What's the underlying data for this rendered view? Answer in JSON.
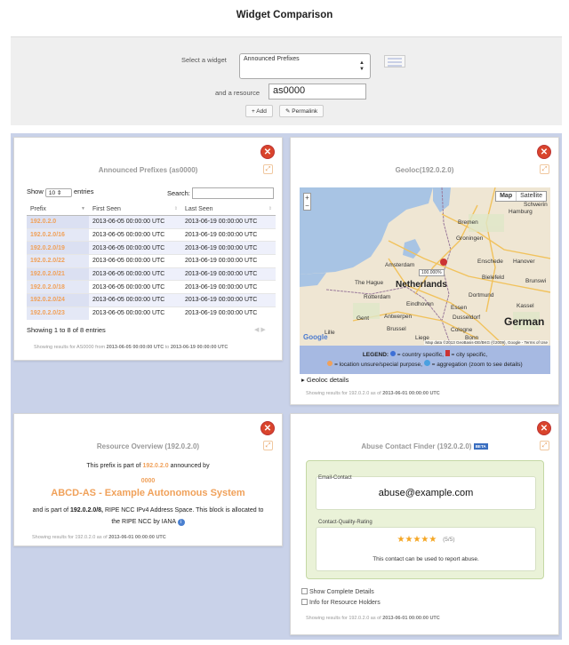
{
  "page": {
    "title": "Widget Comparison"
  },
  "toolbar": {
    "select_label": "Select a widget",
    "select_value": "Announced Prefixes",
    "resource_label": "and a resource",
    "resource_value": "as0000",
    "add_label": "Add",
    "permalink_label": "Permalink"
  },
  "announced": {
    "title": "Announced Prefixes",
    "title_res": "(as0000)",
    "show": "Show",
    "show_value": "10",
    "entries": "entries",
    "search": "Search:",
    "columns": [
      "Prefix",
      "First Seen",
      "Last Seen"
    ],
    "rows": [
      [
        "192.0.2.0",
        "2013-06-05 00:00:00 UTC",
        "2013-06-19 00:00:00 UTC"
      ],
      [
        "192.0.2.0/16",
        "2013-06-05 00:00:00 UTC",
        "2013-06-19 00:00:00 UTC"
      ],
      [
        "192.0.2.0/19",
        "2013-06-05 00:00:00 UTC",
        "2013-06-19 00:00:00 UTC"
      ],
      [
        "192.0.2.0/22",
        "2013-06-05 00:00:00 UTC",
        "2013-06-19 00:00:00 UTC"
      ],
      [
        "192.0.2.0/21",
        "2013-06-05 00:00:00 UTC",
        "2013-06-19 00:00:00 UTC"
      ],
      [
        "192.0.2.0/18",
        "2013-06-05 00:00:00 UTC",
        "2013-06-19 00:00:00 UTC"
      ],
      [
        "192.0.2.0/24",
        "2013-06-05 00:00:00 UTC",
        "2013-06-19 00:00:00 UTC"
      ],
      [
        "192.0.2.0/23",
        "2013-06-05 00:00:00 UTC",
        "2013-06-19 00:00:00 UTC"
      ]
    ],
    "info": "Showing 1 to 8 of 8 entries",
    "foot_pre": "Showing results for",
    "foot_res": "AS0000",
    "foot_from": "from",
    "foot_start": "2013-06-05 00:00:00 UTC",
    "foot_to": "to",
    "foot_end": "2013-06-19 00:00:00 UTC"
  },
  "geoloc": {
    "title": "Geoloc",
    "title_res": "(192.0.2.0)",
    "map_btn": "Map",
    "sat_btn": "Satellite",
    "zoom_in": "+",
    "zoom_out": "−",
    "percent": "100.000%",
    "cities": [
      "Amsterdam",
      "Hamburg",
      "Bremen",
      "The Hague",
      "Rotterdam",
      "Netherlands",
      "Bielefeld",
      "Hanover",
      "Eindhoven",
      "Dortmund",
      "Brunswi",
      "Essen",
      "Antwerpen",
      "Dusseldorf",
      "Gent",
      "Cologne",
      "Bonn",
      "Kassel",
      "German",
      "Lille",
      "Groningen",
      "Schwerin",
      "Brussel",
      "Liege",
      "Enschede"
    ],
    "google": "Google",
    "map_credit": "Map data ©2013 GeoBasis-DE/BKG (©2009), Google - Terms of Use",
    "legend_label": "LEGEND:",
    "legend_country": "= country specific,",
    "legend_city": "= city specific,",
    "legend_unsure": "= location unsure/special purpose,",
    "legend_agg": "= aggregation (zoom to see details)",
    "details": "Geoloc details",
    "foot_pre": "Showing results for",
    "foot_res": "192.0.2.0",
    "foot_as": "as of",
    "foot_date": "2013-06-01 00:00:00 UTC"
  },
  "overview": {
    "title": "Resource Overview",
    "title_res": "(192.0.2.0)",
    "line1_pre": "This prefix is part of",
    "line1_prefix": "192.0.2.0",
    "line1_post": "announced by",
    "asn": "0000",
    "asname": "ABCD-AS - Example Autonomous System",
    "line2_pre": "and is part of",
    "line2_block": "192.0.2.0/8,",
    "line2_post": "RIPE NCC IPv4 Address Space. This block is allocated to",
    "line3": "the RIPE NCC by IANA",
    "foot_pre": "Showing results for",
    "foot_res": "192.0.2.0",
    "foot_as": "as of",
    "foot_date": "2013-06-01 00:00:00 UTC"
  },
  "abuse": {
    "title": "Abuse Contact Finder",
    "title_res": "(192.0.2.0)",
    "beta": "BETA",
    "email_label": "Email-Contact",
    "email": "abuse@example.com",
    "rating_label": "Contact-Quality-Rating",
    "stars": 5,
    "stars_text": "(5/5)",
    "rating_note": "This contact can be used to report abuse.",
    "show_details": "Show Complete Details",
    "info_holders": "Info for Resource Holders",
    "foot_pre": "Showing results for",
    "foot_res": "192.0.2.0",
    "foot_as": "as of",
    "foot_date": "2013-06-01 00:00:00 UTC"
  },
  "colors": {
    "accent": "#f0a15a",
    "close": "#d9442c",
    "bg": "#c9d2e9",
    "abuse_green": "#eaf2d8",
    "star": "#f5a623"
  }
}
